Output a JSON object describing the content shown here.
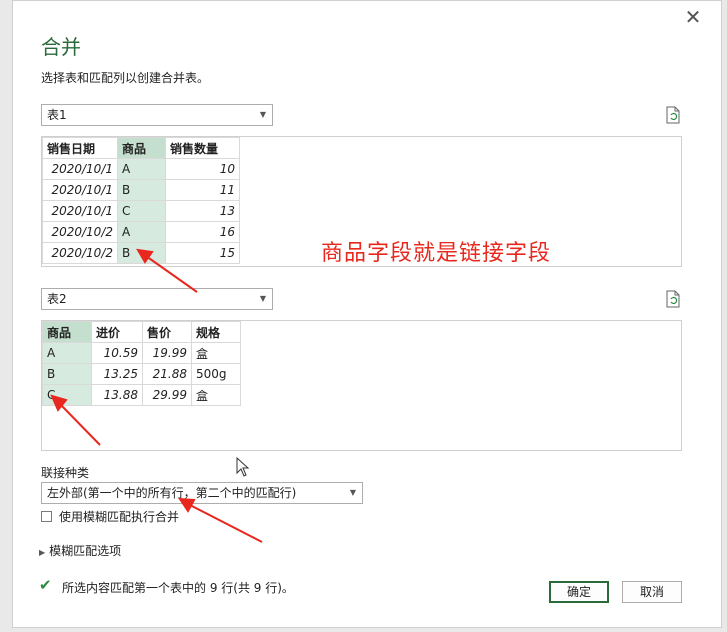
{
  "dialog": {
    "title": "合并",
    "subtitle": "选择表和匹配列以创建合并表。",
    "close_glyph": "✕"
  },
  "table1": {
    "select_value": "表1",
    "headers": [
      "销售日期",
      "商品",
      "销售数量"
    ],
    "rows": [
      [
        "2020/10/1",
        "A",
        "10"
      ],
      [
        "2020/10/1",
        "B",
        "11"
      ],
      [
        "2020/10/1",
        "C",
        "13"
      ],
      [
        "2020/10/2",
        "A",
        "16"
      ],
      [
        "2020/10/2",
        "B",
        "15"
      ]
    ]
  },
  "table2": {
    "select_value": "表2",
    "headers": [
      "商品",
      "进价",
      "售价",
      "规格"
    ],
    "rows": [
      [
        "A",
        "10.59",
        "19.99",
        "盒"
      ],
      [
        "B",
        "13.25",
        "21.88",
        "500g"
      ],
      [
        "C",
        "13.88",
        "29.99",
        "盒"
      ]
    ]
  },
  "join": {
    "label": "联接种类",
    "value": "左外部(第一个中的所有行，第二个中的匹配行)"
  },
  "fuzzy": {
    "checkbox_label": "使用模糊匹配执行合并",
    "options_label": "模糊匹配选项"
  },
  "status": {
    "text": "所选内容匹配第一个表中的 9 行(共 9 行)。"
  },
  "buttons": {
    "ok": "确定",
    "cancel": "取消"
  },
  "annotation": {
    "text": "商品字段就是链接字段",
    "color": "#e8281e"
  },
  "colors": {
    "title": "#2b6a3a",
    "highlight": "#d6eadf"
  },
  "icons": [
    "close-icon",
    "refresh-file-icon",
    "chevron-down-icon",
    "checkmark-icon",
    "triangle-right-icon"
  ]
}
